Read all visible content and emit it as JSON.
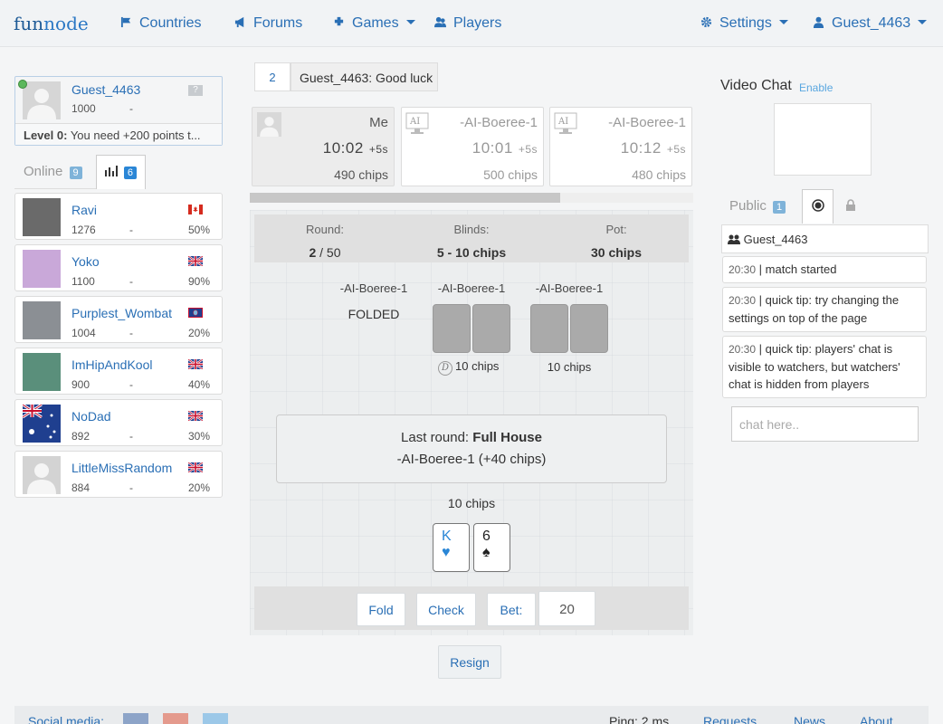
{
  "nav": {
    "logo_a": "fun",
    "logo_b": "node",
    "countries": "Countries",
    "forums": "Forums",
    "games": "Games",
    "players": "Players",
    "settings": "Settings",
    "user": "Guest_4463"
  },
  "me": {
    "name": "Guest_4463",
    "points": "1000",
    "dash": "-",
    "help": "?",
    "level_label": "Level 0:",
    "level_text": "You need +200 points t..."
  },
  "tabs": {
    "online_label": "Online",
    "online_count": "9",
    "rank_count": "6"
  },
  "users": [
    {
      "name": "Ravi",
      "points": "1276",
      "dash": "-",
      "pct": "50%",
      "flag": "canada"
    },
    {
      "name": "Yoko",
      "points": "1100",
      "dash": "-",
      "pct": "90%",
      "flag": "uk"
    },
    {
      "name": "Purplest_Wombat",
      "points": "1004",
      "dash": "-",
      "pct": "20%",
      "flag": "guam"
    },
    {
      "name": "ImHipAndKool",
      "points": "900",
      "dash": "-",
      "pct": "40%",
      "flag": "uk"
    },
    {
      "name": "NoDad",
      "points": "892",
      "dash": "-",
      "pct": "30%",
      "flag": "uk"
    },
    {
      "name": "LittleMissRandom",
      "points": "884",
      "dash": "-",
      "pct": "20%",
      "flag": "uk"
    }
  ],
  "chat_top": {
    "num": "2",
    "text": "Guest_4463: Good luck"
  },
  "players": [
    {
      "name": "Me",
      "time": "10:02",
      "inc": "+5s",
      "chips": "490 chips"
    },
    {
      "name": "-AI-Boeree-1",
      "time": "10:01",
      "inc": "+5s",
      "chips": "500 chips"
    },
    {
      "name": "-AI-Boeree-1",
      "time": "10:12",
      "inc": "+5s",
      "chips": "480 chips"
    }
  ],
  "progress": 0.7,
  "table": {
    "round_label": "Round:",
    "round_value": "2",
    "round_total": "/ 50",
    "blinds_label": "Blinds:",
    "blinds_value": "5 - 10 chips",
    "pot_label": "Pot:",
    "pot_value": "30 chips",
    "seat1_name": "-AI-Boeree-1",
    "seat1_status": "FOLDED",
    "seat2_name": "-AI-Boeree-1",
    "seat2_dealer": "D",
    "seat2_chips": "10 chips",
    "seat3_name": "-AI-Boeree-1",
    "seat3_chips": "10 chips",
    "last_round_label": "Last round:",
    "last_round_hand": "Full House",
    "last_round_winner": "-AI-Boeree-1 (+40 chips)",
    "my_chips": "10 chips",
    "card1_rank": "K",
    "card1_suit": "♥",
    "card2_rank": "6",
    "card2_suit": "♠"
  },
  "actions": {
    "fold": "Fold",
    "check": "Check",
    "bet": "Bet:",
    "bet_value": "20",
    "resign": "Resign"
  },
  "video": {
    "title": "Video Chat",
    "enable": "Enable"
  },
  "chat": {
    "public_label": "Public",
    "public_count": "1",
    "user": "Guest_4463",
    "messages": [
      {
        "time": "20:30",
        "sep": "|",
        "text": "match started"
      },
      {
        "time": "20:30",
        "sep": "|",
        "text": "quick tip: try changing the settings on top of the page"
      },
      {
        "time": "20:30",
        "sep": "|",
        "text": "quick tip: players' chat is visible to watchers, but watchers' chat is hidden from players"
      }
    ],
    "placeholder": "chat here.."
  },
  "footer": {
    "social": "Social media:",
    "ping": "Ping: 2 ms",
    "requests": "Requests",
    "news": "News",
    "about": "About"
  },
  "colors": {
    "accent": "#2a6fb5",
    "badge": "#2a86d6",
    "online_badge": "#7fb3d9"
  }
}
